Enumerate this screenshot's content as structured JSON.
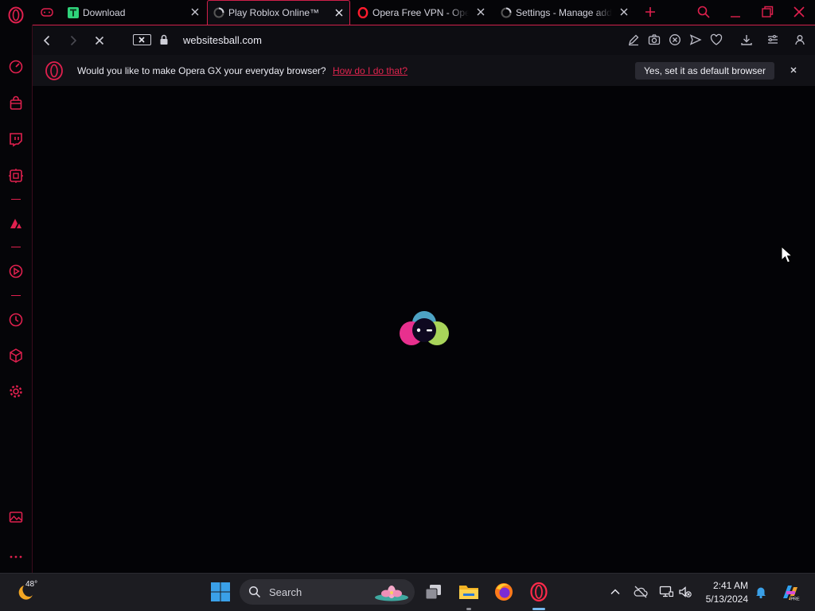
{
  "browser": {
    "name": "Opera GX",
    "accent": "#e0204e"
  },
  "tabs": [
    {
      "title": "Download",
      "favicon": "t-green-icon",
      "active": false
    },
    {
      "title": "Play Roblox Online™",
      "favicon": "loading-icon",
      "active": true
    },
    {
      "title": "Opera Free VPN - Opera",
      "favicon": "opera-icon",
      "active": false
    },
    {
      "title": "Settings - Manage addr",
      "favicon": "loading-icon",
      "active": false
    }
  ],
  "address_bar": {
    "url": "websitesball.com"
  },
  "infobar": {
    "message": "Would you like to make Opera GX your everyday browser?",
    "link": "How do I do that?",
    "button": "Yes, set it as default browser"
  },
  "sidebar": {
    "items": [
      "speedometer-icon",
      "shopping-bag-icon",
      "twitch-icon",
      "gx-corner-icon",
      "player-icon",
      "play-icon",
      "clock-icon",
      "cube-icon",
      "gear-icon",
      "gallery-icon",
      "more-icon"
    ]
  },
  "taskbar": {
    "weather": {
      "temp": "48°"
    },
    "search": {
      "placeholder": "Search"
    },
    "clock": {
      "time": "2:41 AM",
      "date": "5/13/2024"
    },
    "active_color": "#76b9ed"
  }
}
